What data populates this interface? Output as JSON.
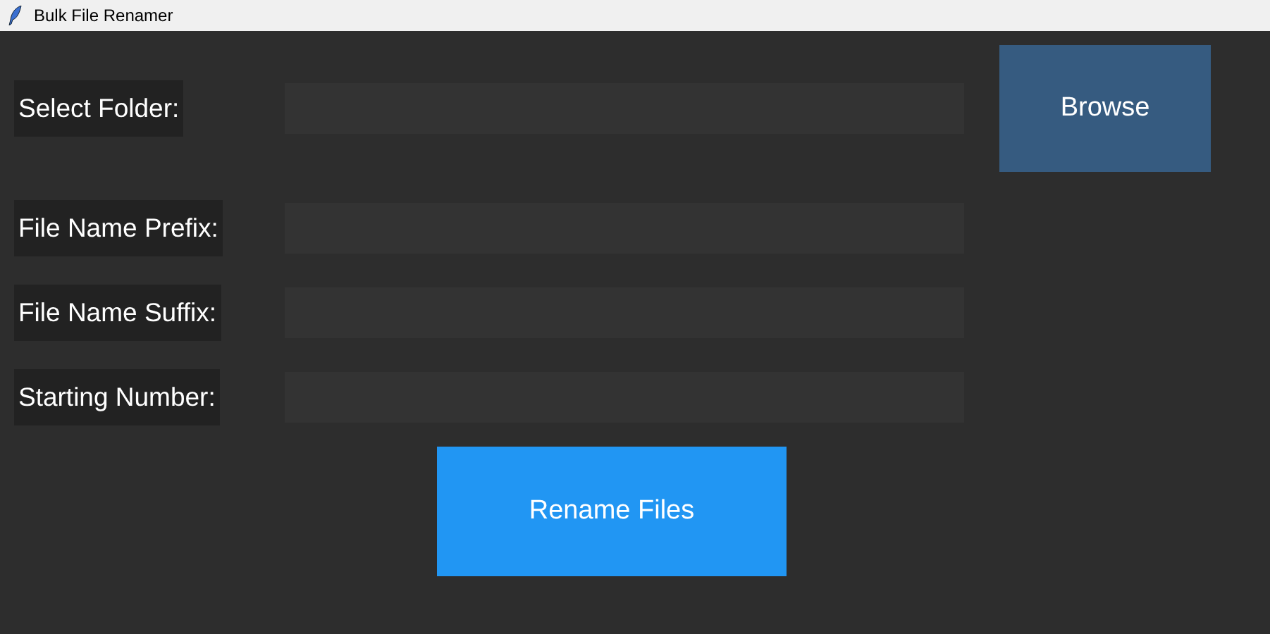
{
  "window": {
    "title": "Bulk File Renamer"
  },
  "fields": [
    {
      "label": "Select Folder:"
    },
    {
      "label": "File Name Prefix:"
    },
    {
      "label": "File Name Suffix:"
    },
    {
      "label": "Starting Number:"
    }
  ],
  "browse_button": "Browse",
  "rename_button": "Rename Files"
}
